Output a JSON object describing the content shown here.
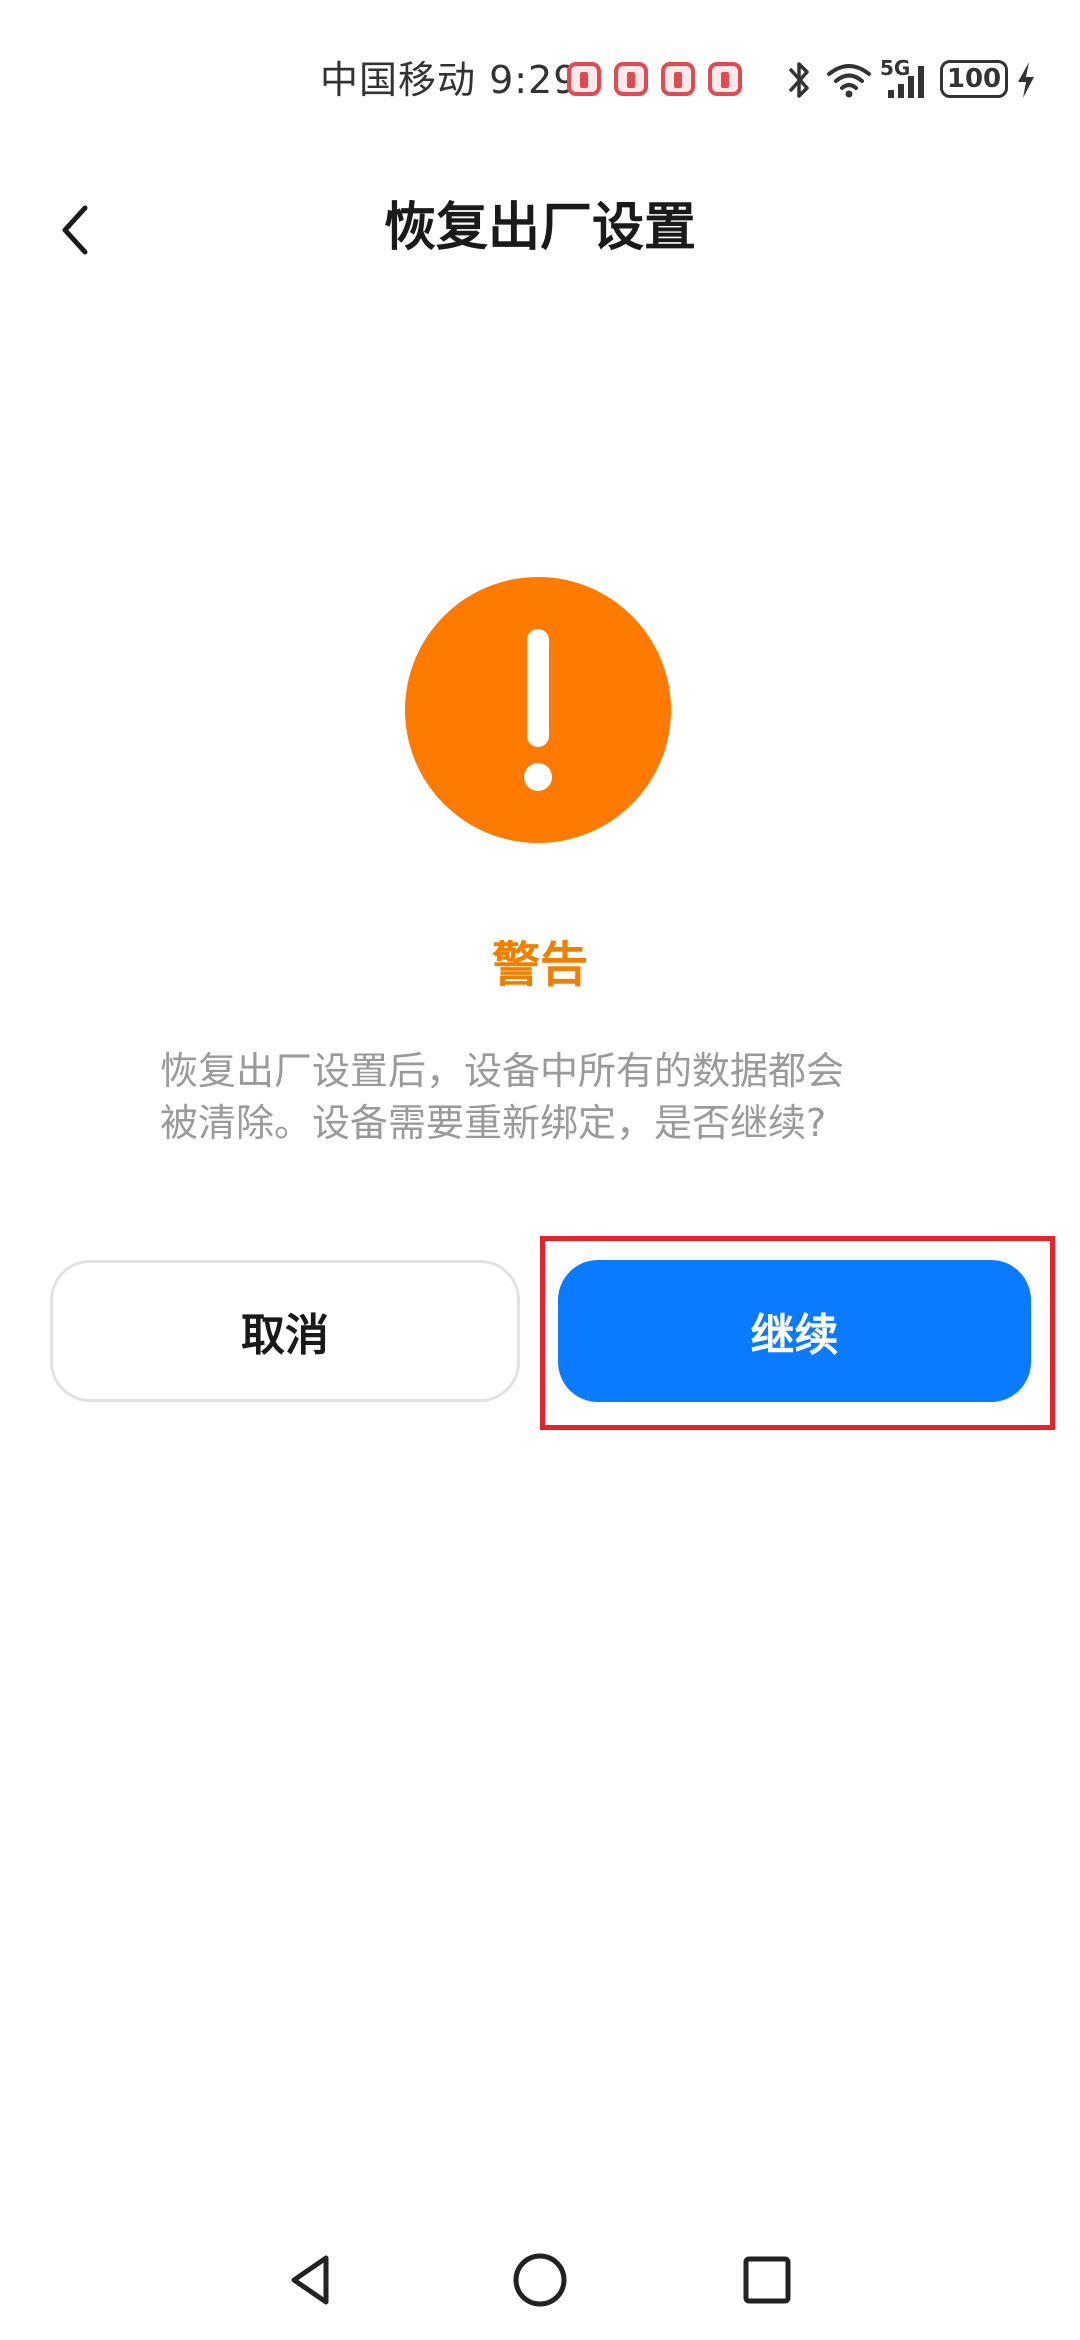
{
  "status_bar": {
    "carrier_time": "中国移动 9:29",
    "network": "5G",
    "battery": "100",
    "notification_color": "#e04b53"
  },
  "header": {
    "back_icon": "chevron-left-icon",
    "title": "恢复出厂设置"
  },
  "warning": {
    "icon": "exclamation-circle-icon",
    "icon_color": "#ff7a00",
    "title": "警告",
    "message_line1": "恢复出厂设置后，设备中所有的数据都会",
    "message_line2": "被清除。设备需要重新绑定，是否继续?"
  },
  "buttons": {
    "cancel_label": "取消",
    "continue_label": "继续",
    "continue_color": "#0a7aff",
    "highlight_color": "#e3242b"
  },
  "nav_bar": {
    "back": "triangle-back-icon",
    "home": "circle-home-icon",
    "recents": "square-recents-icon"
  }
}
